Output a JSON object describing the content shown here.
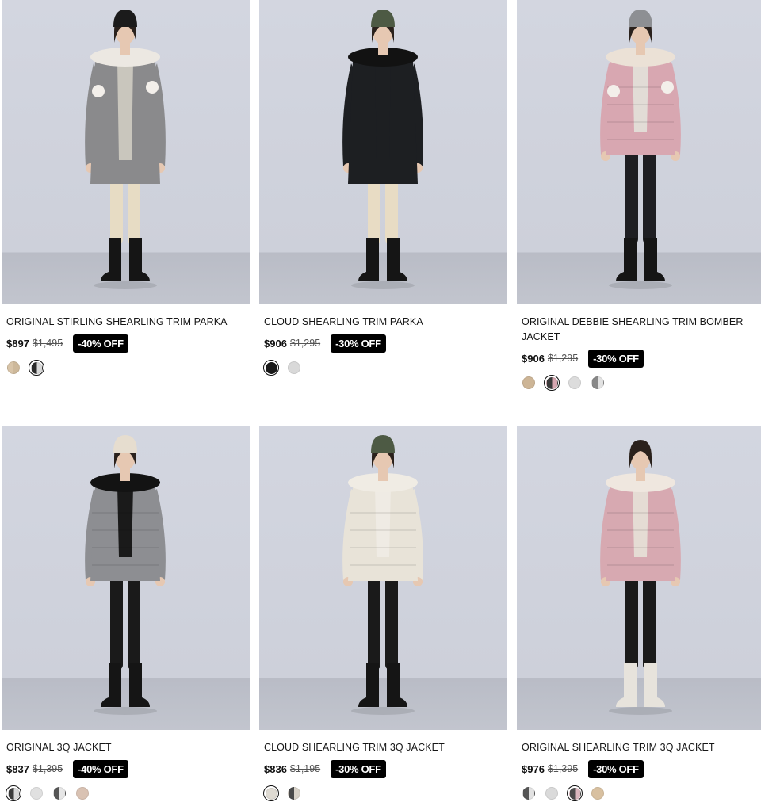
{
  "products": [
    {
      "name": "ORIGINAL STIRLING SHEARLING TRIM PARKA",
      "price": "$897",
      "original_price": "$1,495",
      "discount": "-40% OFF",
      "swatches": [
        {
          "color": "linear-gradient(90deg,#d8c4a8 50%,#cdb89a 50%)",
          "selected": false
        },
        {
          "color": "linear-gradient(90deg,#2b2b2b 50%,#d9d9d9 50%)",
          "selected": true
        }
      ]
    },
    {
      "name": "CLOUD SHEARLING TRIM PARKA",
      "price": "$906",
      "original_price": "$1,295",
      "discount": "-30% OFF",
      "swatches": [
        {
          "color": "#1a1a1a",
          "selected": true
        },
        {
          "color": "#d9d9d9",
          "selected": false
        }
      ]
    },
    {
      "name": "ORIGINAL DEBBIE SHEARLING TRIM BOMBER JACKET",
      "price": "$906",
      "original_price": "$1,295",
      "discount": "-30% OFF",
      "swatches": [
        {
          "color": "#cdb596",
          "selected": false
        },
        {
          "color": "linear-gradient(90deg,#3a3a3a 50%,#d6a6b0 50%)",
          "selected": true
        },
        {
          "color": "#dcdcdc",
          "selected": false
        },
        {
          "color": "linear-gradient(90deg,#888 50%,#e2e2e2 50%)",
          "selected": false
        }
      ]
    },
    {
      "name": "ORIGINAL 3Q JACKET",
      "price": "$837",
      "original_price": "$1,395",
      "discount": "-40% OFF",
      "swatches": [
        {
          "color": "linear-gradient(90deg,#3a3a3a 50%,#d8d8d8 50%)",
          "selected": true
        },
        {
          "color": "#e0e0e0",
          "selected": false
        },
        {
          "color": "linear-gradient(90deg,#555 50%,#e6e6e6 50%)",
          "selected": false
        },
        {
          "color": "#d9c2b3",
          "selected": false
        }
      ]
    },
    {
      "name": "CLOUD SHEARLING TRIM 3Q JACKET",
      "price": "$836",
      "original_price": "$1,195",
      "discount": "-30% OFF",
      "swatches": [
        {
          "color": "#dedad2",
          "selected": true
        },
        {
          "color": "linear-gradient(90deg,#4a4a4a 50%,#d8d2c8 50%)",
          "selected": false
        }
      ]
    },
    {
      "name": "ORIGINAL SHEARLING TRIM 3Q JACKET",
      "price": "$976",
      "original_price": "$1,395",
      "discount": "-30% OFF",
      "swatches": [
        {
          "color": "linear-gradient(90deg,#555 50%,#e2e2e2 50%)",
          "selected": false
        },
        {
          "color": "#dadada",
          "selected": false
        },
        {
          "color": "linear-gradient(90deg,#4a4a4a 50%,#d9b6bd 50%)",
          "selected": true
        },
        {
          "color": "#d8c0a0",
          "selected": false
        }
      ]
    }
  ],
  "figures": [
    {
      "hat": "#1b1b1b",
      "coat": "#8a8a8c",
      "coatLen": "long",
      "inner": "#c9c6bd",
      "legs": "#e7dcc4",
      "boots": "#151515",
      "fur": "#ece8e2",
      "pom": true
    },
    {
      "hat": "#4d5a44",
      "coat": "#1d1f22",
      "coatLen": "long",
      "inner": "#1d1f22",
      "legs": "#e8dcc4",
      "boots": "#151515",
      "fur": "#121212",
      "pom": false
    },
    {
      "hat": "#8d8f93",
      "coat": "#d8a7b1",
      "coatLen": "short",
      "inner": "#e2dcd6",
      "legs": "#1e1e22",
      "boots": "#151515",
      "fur": "#ebe1d6",
      "pom": true
    },
    {
      "hat": "#e6ddcf",
      "coat": "#8d8e92",
      "coatLen": "short",
      "inner": "#1a1a1a",
      "legs": "#1a1a1a",
      "boots": "#151515",
      "fur": "#131313",
      "pom": false
    },
    {
      "hat": "#4d5a44",
      "coat": "#e8e3d8",
      "coatLen": "short",
      "inner": "#efebe4",
      "legs": "#1a1a1a",
      "boots": "#151515",
      "fur": "#f0ece4",
      "pom": false
    },
    {
      "hat": "",
      "coat": "#d7a9b1",
      "coatLen": "short",
      "inner": "#e5dcd4",
      "legs": "#1a1a1a",
      "boots": "#e7e3dc",
      "fur": "#efe7df",
      "pom": false
    }
  ]
}
